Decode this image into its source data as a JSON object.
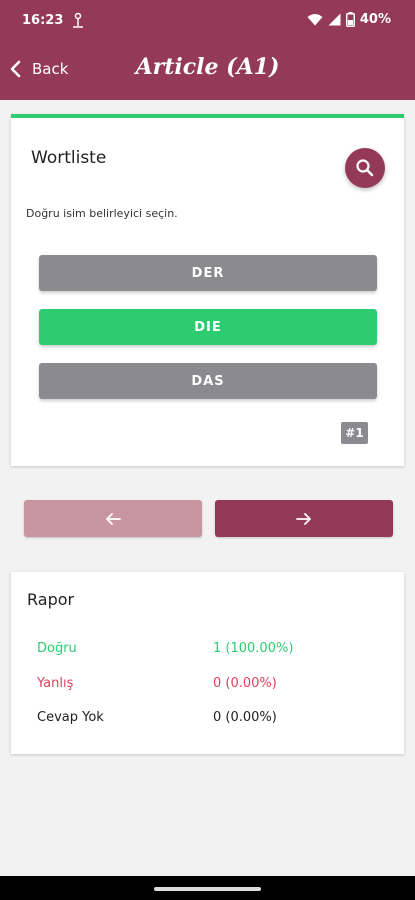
{
  "status_bar": {
    "time": "16:23",
    "battery": "40%"
  },
  "header": {
    "back_label": "Back",
    "title": "Article (A1)"
  },
  "quiz": {
    "card_title": "Wortliste",
    "instruction": "Doğru isim belirleyici seçin.",
    "options": [
      {
        "label": "DER",
        "state": "neutral"
      },
      {
        "label": "DIE",
        "state": "correct"
      },
      {
        "label": "DAS",
        "state": "neutral"
      }
    ],
    "question_number": "#1"
  },
  "navigation": {
    "prev_icon": "arrow-left-icon",
    "next_icon": "arrow-right-icon"
  },
  "report": {
    "title": "Rapor",
    "rows": [
      {
        "label": "Doğru",
        "value": "1 (100.00%)"
      },
      {
        "label": "Yanlış",
        "value": "0 (0.00%)"
      },
      {
        "label": "Cevap Yok",
        "value": "0 (0.00%)"
      }
    ]
  },
  "colors": {
    "brand": "#943a58",
    "brand_light": "#c9959f",
    "correct": "#2ecc71",
    "wrong": "#e0405e",
    "neutral": "#8a8a8f"
  }
}
